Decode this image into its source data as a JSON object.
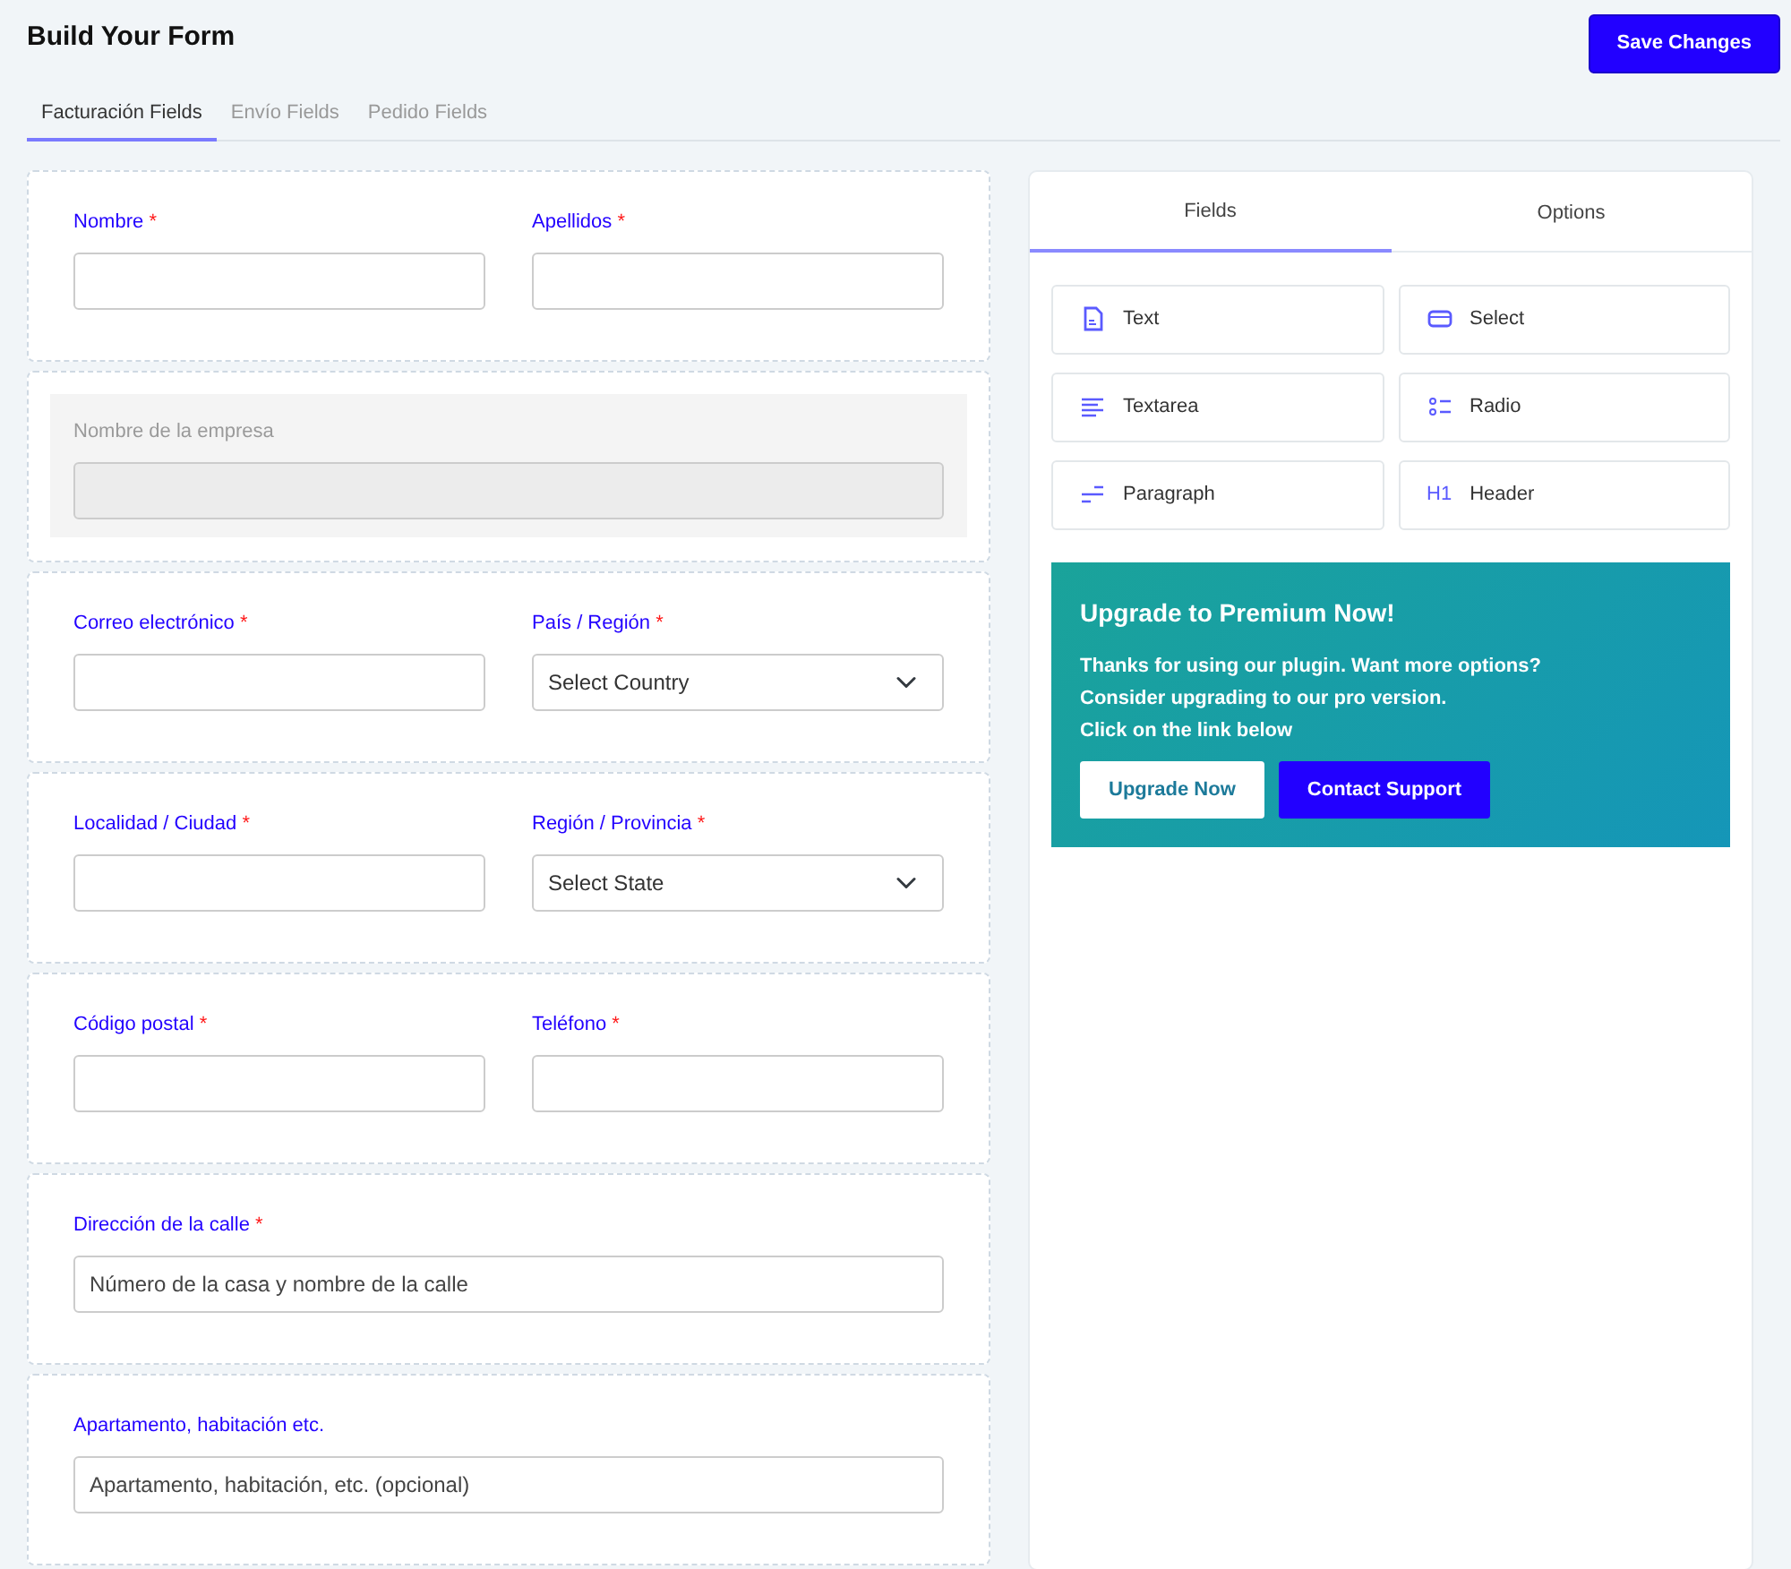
{
  "title": "Build Your Form",
  "save_button": "Save Changes",
  "tabs": [
    {
      "label": "Facturación Fields",
      "selected": true
    },
    {
      "label": "Envío Fields",
      "selected": false
    },
    {
      "label": "Pedido Fields",
      "selected": false
    }
  ],
  "rows": [
    {
      "disabled": false,
      "fields": [
        {
          "label": "Nombre",
          "required_mark": "*",
          "kind": "input"
        },
        {
          "label": "Apellidos",
          "required_mark": "*",
          "kind": "input"
        }
      ]
    },
    {
      "disabled": true,
      "fields": [
        {
          "label": "Nombre de la empresa",
          "kind": "input"
        }
      ]
    },
    {
      "disabled": false,
      "fields": [
        {
          "label": "Correo electrónico",
          "required_mark": "*",
          "kind": "input"
        },
        {
          "label": "País / Región",
          "required_mark": "*",
          "kind": "select",
          "value": "Select Country"
        }
      ]
    },
    {
      "disabled": false,
      "fields": [
        {
          "label": "Localidad / Ciudad",
          "required_mark": "*",
          "kind": "input"
        },
        {
          "label": "Región / Provincia",
          "required_mark": "*",
          "kind": "select",
          "value": "Select State"
        }
      ]
    },
    {
      "disabled": false,
      "fields": [
        {
          "label": "Código postal",
          "required_mark": "*",
          "kind": "input"
        },
        {
          "label": "Teléfono",
          "required_mark": "*",
          "kind": "input"
        }
      ]
    },
    {
      "disabled": false,
      "fields": [
        {
          "label": "Dirección de la calle",
          "required_mark": "*",
          "kind": "input",
          "placeholder": "Número de la casa y nombre de la calle"
        }
      ]
    },
    {
      "disabled": false,
      "fields": [
        {
          "label": "Apartamento, habitación etc.",
          "kind": "input",
          "placeholder": "Apartamento, habitación, etc. (opcional)"
        }
      ]
    }
  ],
  "panel_tabs": [
    {
      "label": "Fields",
      "selected": true
    },
    {
      "label": "Options",
      "selected": false
    }
  ],
  "widgets": [
    {
      "kind": "text",
      "label": "Text"
    },
    {
      "kind": "select",
      "label": "Select"
    },
    {
      "kind": "textarea",
      "label": "Textarea"
    },
    {
      "kind": "radio",
      "label": "Radio"
    },
    {
      "kind": "paragraph",
      "label": "Paragraph"
    },
    {
      "kind": "header",
      "label": "Header",
      "icon_text": "H1"
    }
  ],
  "promo": {
    "title": "Upgrade to Premium Now!",
    "lines": [
      "Thanks for using our plugin. Want more options?",
      "Consider upgrading to our pro version.",
      "Click on the link below"
    ],
    "buttons": [
      {
        "label": "Upgrade Now",
        "kind": "light"
      },
      {
        "label": "Contact Support",
        "kind": "primary"
      }
    ]
  }
}
